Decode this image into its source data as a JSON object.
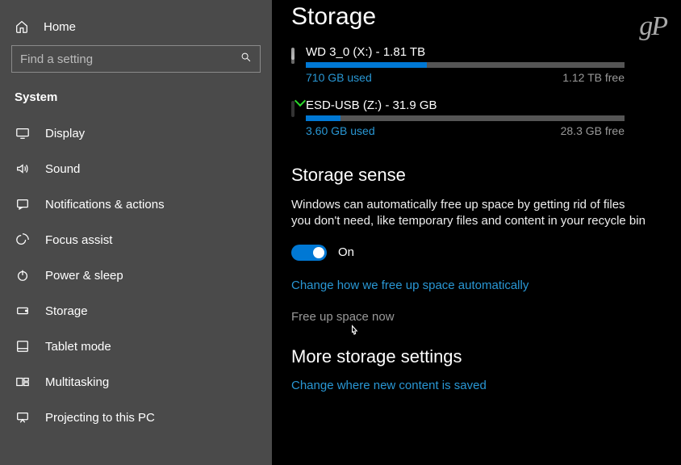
{
  "watermark": "gP",
  "sidebar": {
    "home_label": "Home",
    "search_placeholder": "Find a setting",
    "section_label": "System",
    "items": [
      {
        "label": "Display"
      },
      {
        "label": "Sound"
      },
      {
        "label": "Notifications & actions"
      },
      {
        "label": "Focus assist"
      },
      {
        "label": "Power & sleep"
      },
      {
        "label": "Storage"
      },
      {
        "label": "Tablet mode"
      },
      {
        "label": "Multitasking"
      },
      {
        "label": "Projecting to this PC"
      }
    ]
  },
  "main": {
    "title": "Storage",
    "drives": [
      {
        "name": "WD 3_0 (X:) - 1.81 TB",
        "used": "710 GB used",
        "free": "1.12 TB free",
        "fill_pct": 38,
        "type": "hdd"
      },
      {
        "name": "ESD-USB (Z:) - 31.9 GB",
        "used": "3.60 GB used",
        "free": "28.3 GB free",
        "fill_pct": 11,
        "type": "usb"
      }
    ],
    "sense_heading": "Storage sense",
    "sense_desc": "Windows can automatically free up space by getting rid of files you don't need, like temporary files and content in your recycle bin",
    "toggle_state": "On",
    "link_change": "Change how we free up space automatically",
    "link_free": "Free up space now",
    "more_heading": "More storage settings",
    "link_newcontent": "Change where new content is saved"
  }
}
